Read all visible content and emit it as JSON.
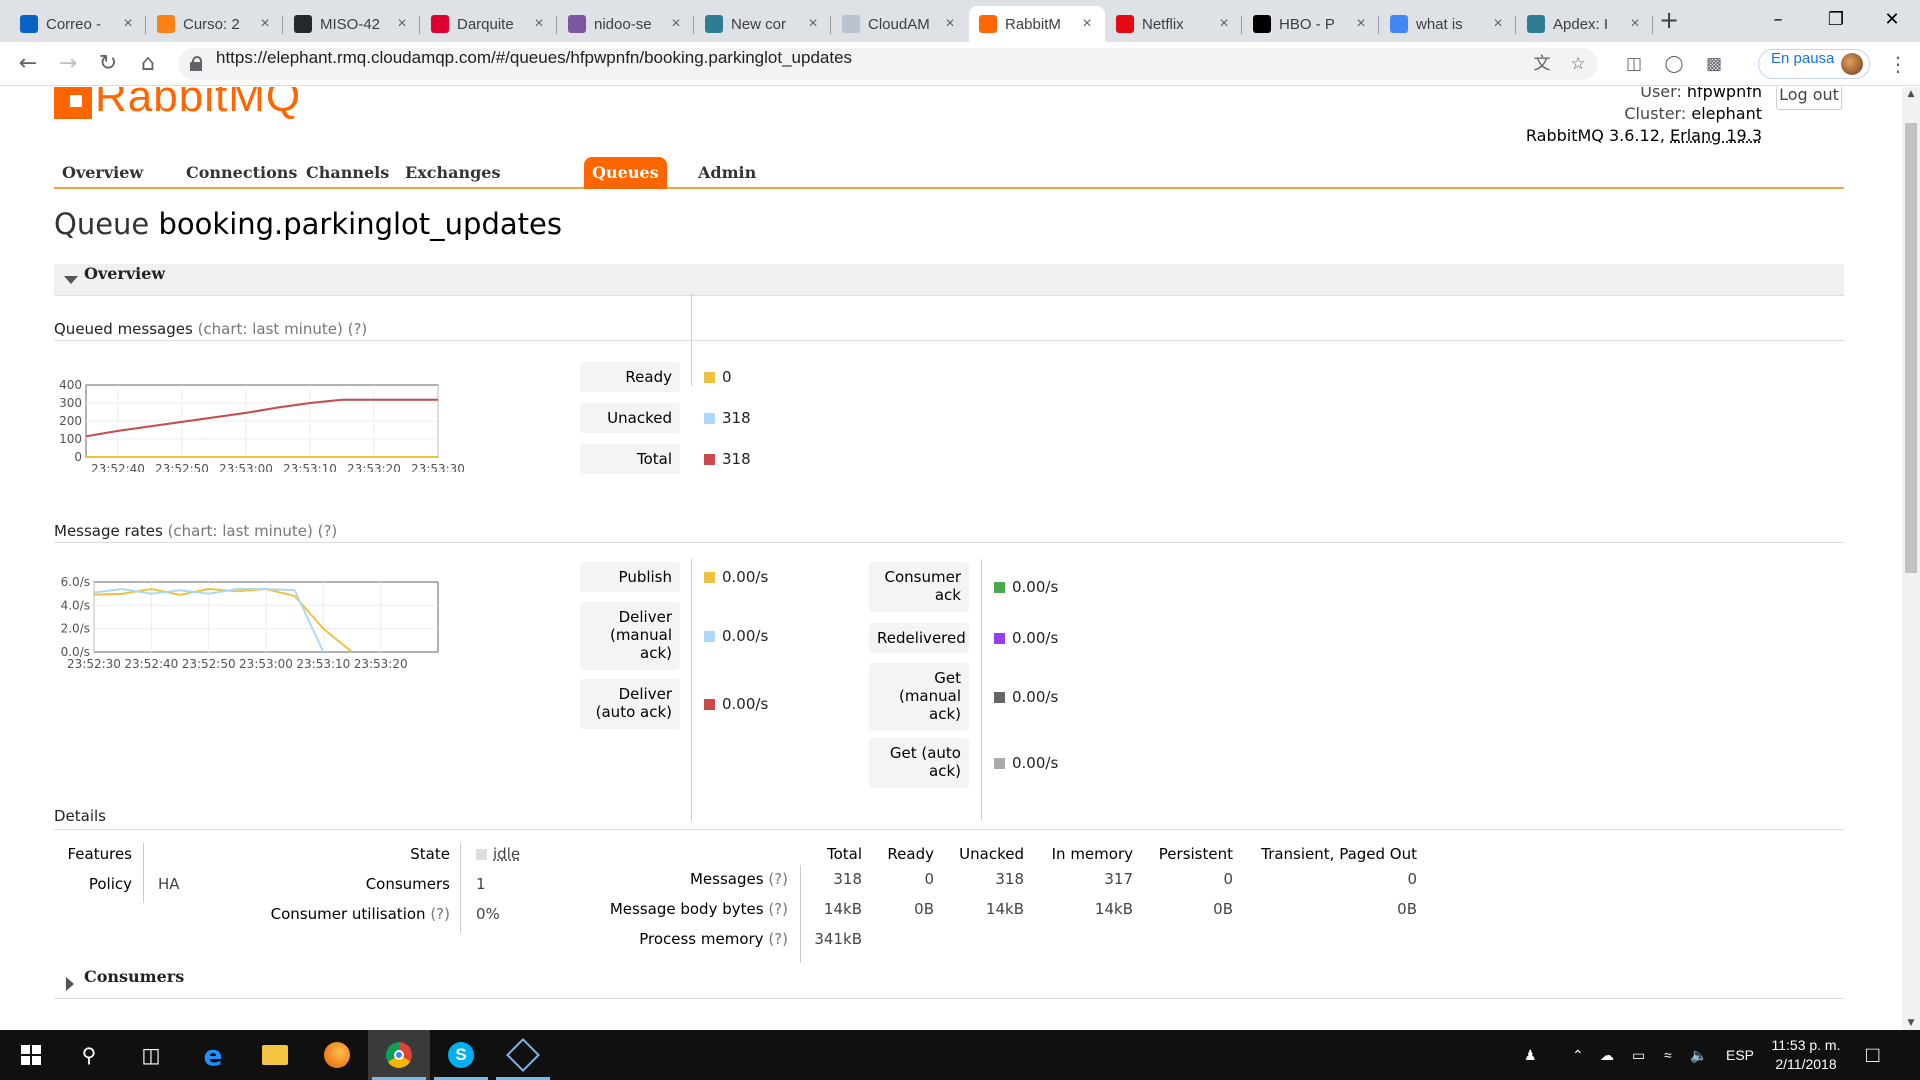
{
  "browser": {
    "tabs": [
      {
        "title": "Correo -",
        "favicon": "outlook-icon",
        "color": "#0a64c8"
      },
      {
        "title": "Curso: 2",
        "favicon": "moodle-icon",
        "color": "#f98012"
      },
      {
        "title": "MISO-42",
        "favicon": "github-icon",
        "color": "#24292e"
      },
      {
        "title": "Darquite",
        "favicon": "angular-icon",
        "color": "#dd0031"
      },
      {
        "title": "nidoo-se",
        "favicon": "heroku-icon",
        "color": "#79589f"
      },
      {
        "title": "New cor",
        "favicon": "app-icon",
        "color": "#2e7d92"
      },
      {
        "title": "CloudAM",
        "favicon": "cloud-icon",
        "color": "#b9c4cf"
      },
      {
        "title": "RabbitM",
        "favicon": "rabbitmq-icon",
        "color": "#ff6600"
      },
      {
        "title": "Netflix",
        "favicon": "netflix-icon",
        "color": "#e50914"
      },
      {
        "title": "HBO - P",
        "favicon": "hbo-icon",
        "color": "#000000"
      },
      {
        "title": "what is",
        "favicon": "google-icon",
        "color": "#4285f4"
      },
      {
        "title": "Apdex: I",
        "favicon": "app-icon",
        "color": "#2e7d92"
      }
    ],
    "active_tab": 7,
    "url": "https://elephant.rmq.cloudamqp.com/#/queues/hfpwpnfn/booking.parkinglot_updates",
    "profile_label": "En pausa"
  },
  "header": {
    "logo_text": "RabbitMQ",
    "user_label": "User:",
    "user": "hfpwpnfn",
    "cluster_label": "Cluster:",
    "cluster": "elephant",
    "version": "RabbitMQ 3.6.12,",
    "erlang": "Erlang 19.3",
    "logout_label": "Log out"
  },
  "nav": {
    "items": [
      "Overview",
      "Connections",
      "Channels",
      "Exchanges",
      "Queues",
      "Admin"
    ],
    "active": 4
  },
  "page": {
    "title_prefix": "Queue",
    "queue_name": "booking.parkinglot_updates"
  },
  "overview": {
    "section_label": "Overview",
    "queued_label": "Queued messages",
    "queued_hint": "(chart: last minute) (?)",
    "queued_legend": [
      {
        "label": "Ready",
        "value": "0",
        "color": "#edc240"
      },
      {
        "label": "Unacked",
        "value": "318",
        "color": "#afd8f8"
      },
      {
        "label": "Total",
        "value": "318",
        "color": "#cb4b4b"
      }
    ],
    "rates_label": "Message rates",
    "rates_hint": "(chart: last minute) (?)",
    "rates_legend_left": [
      {
        "label": "Publish",
        "value": "0.00/s",
        "color": "#edc240"
      },
      {
        "label": "Deliver (manual ack)",
        "value": "0.00/s",
        "color": "#afd8f8"
      },
      {
        "label": "Deliver (auto ack)",
        "value": "0.00/s",
        "color": "#cb4b4b"
      }
    ],
    "rates_legend_right": [
      {
        "label": "Consumer ack",
        "value": "0.00/s",
        "color": "#4da74d"
      },
      {
        "label": "Redelivered",
        "value": "0.00/s",
        "color": "#9440ed"
      },
      {
        "label": "Get (manual ack)",
        "value": "0.00/s",
        "color": "#666666"
      },
      {
        "label": "Get (auto ack)",
        "value": "0.00/s",
        "color": "#aaaaaa"
      }
    ]
  },
  "chart_data": [
    {
      "type": "line",
      "title": "Queued messages",
      "x": [
        "23:52:35",
        "23:52:40",
        "23:52:45",
        "23:52:50",
        "23:52:55",
        "23:53:00",
        "23:53:05",
        "23:53:10",
        "23:53:15",
        "23:53:20",
        "23:53:25",
        "23:53:30"
      ],
      "x_ticks": [
        "23:52:40",
        "23:52:50",
        "23:53:00",
        "23:53:10",
        "23:53:20",
        "23:53:30"
      ],
      "y_ticks": [
        "0",
        "100",
        "200",
        "300",
        "400"
      ],
      "ylim": [
        0,
        400
      ],
      "series": [
        {
          "name": "Ready",
          "color": "#edc240",
          "values": [
            0,
            0,
            0,
            0,
            0,
            0,
            0,
            0,
            0,
            0,
            0,
            0
          ]
        },
        {
          "name": "Unacked",
          "color": "#afd8f8",
          "values": [
            115,
            145,
            170,
            195,
            220,
            245,
            275,
            300,
            318,
            318,
            318,
            318
          ]
        },
        {
          "name": "Total",
          "color": "#cb4b4b",
          "values": [
            115,
            145,
            170,
            195,
            220,
            245,
            275,
            300,
            318,
            318,
            318,
            318
          ]
        }
      ],
      "grid": true
    },
    {
      "type": "line",
      "title": "Message rates",
      "x": [
        "23:52:30",
        "23:52:35",
        "23:52:40",
        "23:52:45",
        "23:52:50",
        "23:52:55",
        "23:53:00",
        "23:53:05",
        "23:53:10",
        "23:53:15",
        "23:53:20",
        "23:53:25",
        "23:53:30"
      ],
      "x_ticks": [
        "23:52:30",
        "23:52:40",
        "23:52:50",
        "23:53:00",
        "23:53:10",
        "23:53:20"
      ],
      "y_ticks": [
        "0.0/s",
        "2.0/s",
        "4.0/s",
        "6.0/s"
      ],
      "ylim": [
        0,
        6
      ],
      "series": [
        {
          "name": "Publish",
          "color": "#edc240",
          "values": [
            4.9,
            5.0,
            5.4,
            4.9,
            5.4,
            5.2,
            5.4,
            4.8,
            2.0,
            0.0,
            null,
            null,
            null
          ]
        },
        {
          "name": "Deliver (manual ack)",
          "color": "#afd8f8",
          "values": [
            5.1,
            5.4,
            5.0,
            5.3,
            5.0,
            5.4,
            5.4,
            5.3,
            0.0,
            null,
            null,
            null,
            null
          ]
        }
      ],
      "grid": true
    }
  ],
  "details": {
    "label": "Details",
    "features_label": "Features",
    "policy_label": "Policy",
    "policy_value": "HA",
    "state_label": "State",
    "state_value": "idle",
    "consumers_label": "Consumers",
    "consumers_value": "1",
    "utilisation_label": "Consumer utilisation",
    "utilisation_hint": "(?)",
    "utilisation_value": "0%",
    "table_headers": [
      "Total",
      "Ready",
      "Unacked",
      "In memory",
      "Persistent",
      "Transient, Paged Out"
    ],
    "rows": [
      {
        "label": "Messages",
        "hint": "(?)",
        "values": [
          "318",
          "0",
          "318",
          "317",
          "0",
          "0"
        ]
      },
      {
        "label": "Message body bytes",
        "hint": "(?)",
        "values": [
          "14kB",
          "0B",
          "14kB",
          "14kB",
          "0B",
          "0B"
        ]
      },
      {
        "label": "Process memory",
        "hint": "(?)",
        "values": [
          "341kB",
          "",
          "",
          "",
          "",
          ""
        ]
      }
    ]
  },
  "consumers_section": {
    "label": "Consumers"
  },
  "taskbar": {
    "language": "ESP",
    "time": "11:53 p. m.",
    "date": "2/11/2018"
  }
}
